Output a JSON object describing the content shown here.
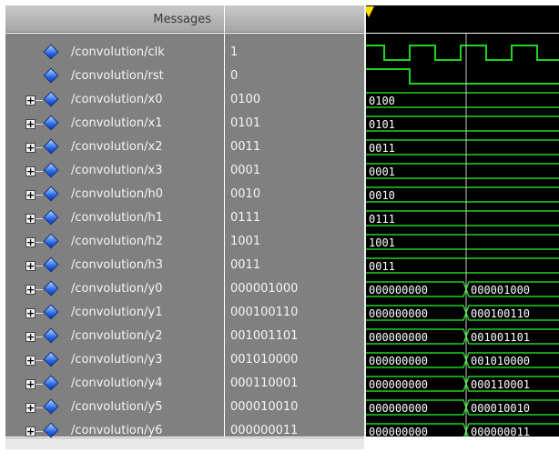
{
  "header": {
    "messages_title": "Messages"
  },
  "colors": {
    "wave": "#1fd31f",
    "background": "#000000",
    "cursor_line": "#c8c8c8",
    "cursor_marker": "#ffe000",
    "panel": "#808080",
    "icon": "diamond-signal-icon"
  },
  "signals": [
    {
      "name": "/convolution/clk",
      "value": "1",
      "kind": "clock",
      "expandable": false
    },
    {
      "name": "/convolution/rst",
      "value": "0",
      "kind": "bit",
      "expandable": false,
      "waveform": {
        "before": "1",
        "after": "0"
      }
    },
    {
      "name": "/convolution/x0",
      "value": "0100",
      "kind": "bus",
      "expandable": true,
      "waveform": {
        "before": "0100",
        "after": ""
      }
    },
    {
      "name": "/convolution/x1",
      "value": "0101",
      "kind": "bus",
      "expandable": true,
      "waveform": {
        "before": "0101",
        "after": ""
      }
    },
    {
      "name": "/convolution/x2",
      "value": "0011",
      "kind": "bus",
      "expandable": true,
      "waveform": {
        "before": "0011",
        "after": ""
      }
    },
    {
      "name": "/convolution/x3",
      "value": "0001",
      "kind": "bus",
      "expandable": true,
      "waveform": {
        "before": "0001",
        "after": ""
      }
    },
    {
      "name": "/convolution/h0",
      "value": "0010",
      "kind": "bus",
      "expandable": true,
      "waveform": {
        "before": "0010",
        "after": ""
      }
    },
    {
      "name": "/convolution/h1",
      "value": "0111",
      "kind": "bus",
      "expandable": true,
      "waveform": {
        "before": "0111",
        "after": ""
      }
    },
    {
      "name": "/convolution/h2",
      "value": "1001",
      "kind": "bus",
      "expandable": true,
      "waveform": {
        "before": "1001",
        "after": ""
      }
    },
    {
      "name": "/convolution/h3",
      "value": "0011",
      "kind": "bus",
      "expandable": true,
      "waveform": {
        "before": "0011",
        "after": ""
      }
    },
    {
      "name": "/convolution/y0",
      "value": "000001000",
      "kind": "bus",
      "expandable": true,
      "waveform": {
        "before": "000000000",
        "after": "000001000"
      }
    },
    {
      "name": "/convolution/y1",
      "value": "000100110",
      "kind": "bus",
      "expandable": true,
      "waveform": {
        "before": "000000000",
        "after": "000100110"
      }
    },
    {
      "name": "/convolution/y2",
      "value": "001001101",
      "kind": "bus",
      "expandable": true,
      "waveform": {
        "before": "000000000",
        "after": "001001101"
      }
    },
    {
      "name": "/convolution/y3",
      "value": "001010000",
      "kind": "bus",
      "expandable": true,
      "waveform": {
        "before": "000000000",
        "after": "001010000"
      }
    },
    {
      "name": "/convolution/y4",
      "value": "000110001",
      "kind": "bus",
      "expandable": true,
      "waveform": {
        "before": "000000000",
        "after": "000110001"
      }
    },
    {
      "name": "/convolution/y5",
      "value": "000010010",
      "kind": "bus",
      "expandable": true,
      "waveform": {
        "before": "000000000",
        "after": "000010010"
      }
    },
    {
      "name": "/convolution/y6",
      "value": "000000011",
      "kind": "bus",
      "expandable": true,
      "waveform": {
        "before": "000000000",
        "after": "000000011"
      }
    }
  ]
}
